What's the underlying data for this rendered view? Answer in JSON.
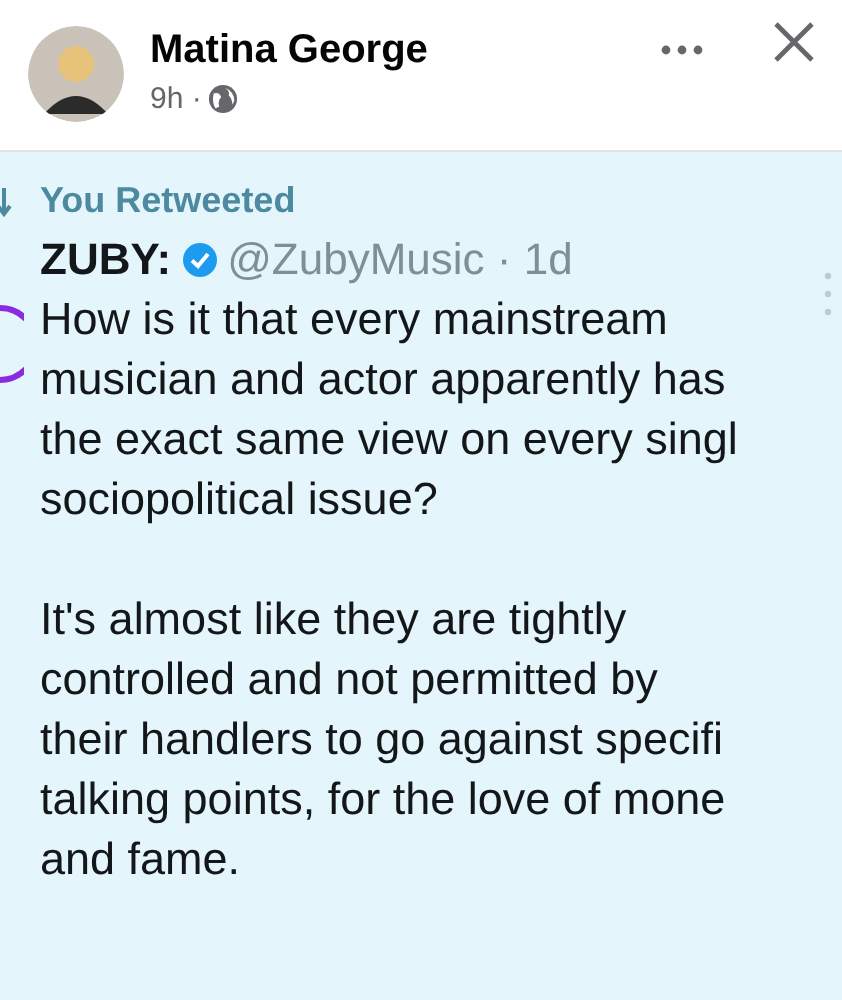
{
  "post": {
    "author": "Matina George",
    "time": "9h ·"
  },
  "tweet": {
    "retweet_label": "You Retweeted",
    "name": "ZUBY:",
    "handle": "@ZubyMusic · 1d",
    "paragraphs": [
      [
        "How is it that every mainstream",
        "musician and actor apparently has",
        "the exact same view on every singl",
        "sociopolitical issue?"
      ],
      [
        "It's almost like they are tightly",
        "controlled and not permitted by",
        "their handlers to go against specifi",
        "talking points, for the love of mone",
        "and fame."
      ]
    ]
  }
}
